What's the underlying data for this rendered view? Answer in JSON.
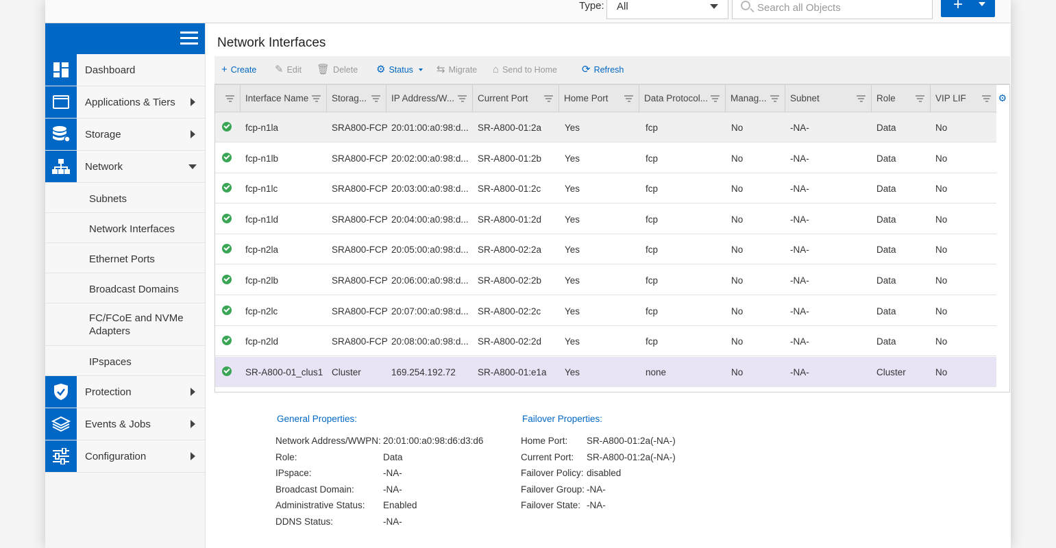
{
  "topbar": {
    "type_label": "Type:",
    "type_value": "All",
    "search_placeholder": "Search all Objects",
    "add_label": "+"
  },
  "sidebar": {
    "items": [
      {
        "label": "Dashboard",
        "icon": "dashboard-icon"
      },
      {
        "label": "Applications & Tiers",
        "icon": "applications-icon"
      },
      {
        "label": "Storage",
        "icon": "storage-icon"
      },
      {
        "label": "Network",
        "icon": "network-icon"
      }
    ],
    "network_subitems": [
      "Subnets",
      "Network Interfaces",
      "Ethernet Ports",
      "Broadcast Domains",
      "FC/FCoE and NVMe Adapters",
      "IPspaces"
    ],
    "bottom_items": [
      {
        "label": "Protection",
        "icon": "shield-icon"
      },
      {
        "label": "Events & Jobs",
        "icon": "layers-icon"
      },
      {
        "label": "Configuration",
        "icon": "sliders-icon"
      }
    ]
  },
  "main": {
    "title": "Network Interfaces",
    "toolbar": {
      "create": "Create",
      "edit": "Edit",
      "delete": "Delete",
      "status": "Status",
      "migrate": "Migrate",
      "send_home": "Send to Home",
      "refresh": "Refresh"
    },
    "columns": [
      "Interface Name",
      "Storag...",
      "IP Address/W...",
      "Current Port",
      "Home Port",
      "Data Protocol...",
      "Manag...",
      "Subnet",
      "Role",
      "VIP LIF"
    ],
    "rows": [
      [
        "fcp-n1la",
        "SRA800-FCP",
        "20:01:00:a0:98:d...",
        "SR-A800-01:2a",
        "Yes",
        "fcp",
        "No",
        "-NA-",
        "Data",
        "No"
      ],
      [
        "fcp-n1lb",
        "SRA800-FCP",
        "20:02:00:a0:98:d...",
        "SR-A800-01:2b",
        "Yes",
        "fcp",
        "No",
        "-NA-",
        "Data",
        "No"
      ],
      [
        "fcp-n1lc",
        "SRA800-FCP",
        "20:03:00:a0:98:d...",
        "SR-A800-01:2c",
        "Yes",
        "fcp",
        "No",
        "-NA-",
        "Data",
        "No"
      ],
      [
        "fcp-n1ld",
        "SRA800-FCP",
        "20:04:00:a0:98:d...",
        "SR-A800-01:2d",
        "Yes",
        "fcp",
        "No",
        "-NA-",
        "Data",
        "No"
      ],
      [
        "fcp-n2la",
        "SRA800-FCP",
        "20:05:00:a0:98:d...",
        "SR-A800-02:2a",
        "Yes",
        "fcp",
        "No",
        "-NA-",
        "Data",
        "No"
      ],
      [
        "fcp-n2lb",
        "SRA800-FCP",
        "20:06:00:a0:98:d...",
        "SR-A800-02:2b",
        "Yes",
        "fcp",
        "No",
        "-NA-",
        "Data",
        "No"
      ],
      [
        "fcp-n2lc",
        "SRA800-FCP",
        "20:07:00:a0:98:d...",
        "SR-A800-02:2c",
        "Yes",
        "fcp",
        "No",
        "-NA-",
        "Data",
        "No"
      ],
      [
        "fcp-n2ld",
        "SRA800-FCP",
        "20:08:00:a0:98:d...",
        "SR-A800-02:2d",
        "Yes",
        "fcp",
        "No",
        "-NA-",
        "Data",
        "No"
      ],
      [
        "SR-A800-01_clus1",
        "Cluster",
        "169.254.192.72",
        "SR-A800-01:e1a",
        "Yes",
        "none",
        "No",
        "-NA-",
        "Cluster",
        "No"
      ]
    ]
  },
  "details": {
    "general_title": "General Properties:",
    "general": [
      {
        "label": "Network Address/WWPN:",
        "value": "20:01:00:a0:98:d6:d3:d6"
      },
      {
        "label": "Role:",
        "value": "Data"
      },
      {
        "label": "IPspace:",
        "value": "-NA-"
      },
      {
        "label": "Broadcast Domain:",
        "value": "-NA-"
      },
      {
        "label": "Administrative Status:",
        "value": "Enabled"
      },
      {
        "label": "DDNS Status:",
        "value": "-NA-"
      }
    ],
    "failover_title": "Failover Properties:",
    "failover": [
      {
        "label": "Home Port:",
        "value": "SR-A800-01:2a(-NA-)"
      },
      {
        "label": "Current Port:",
        "value": "SR-A800-01:2a(-NA-)"
      },
      {
        "label": "Failover Policy:",
        "value": "disabled"
      },
      {
        "label": "Failover Group:",
        "value": "-NA-"
      },
      {
        "label": "Failover State:",
        "value": "-NA-"
      }
    ]
  },
  "colors": {
    "accent": "#0067c5",
    "status_ok": "#3aa655",
    "highlight_row": "#e9e4f5"
  }
}
